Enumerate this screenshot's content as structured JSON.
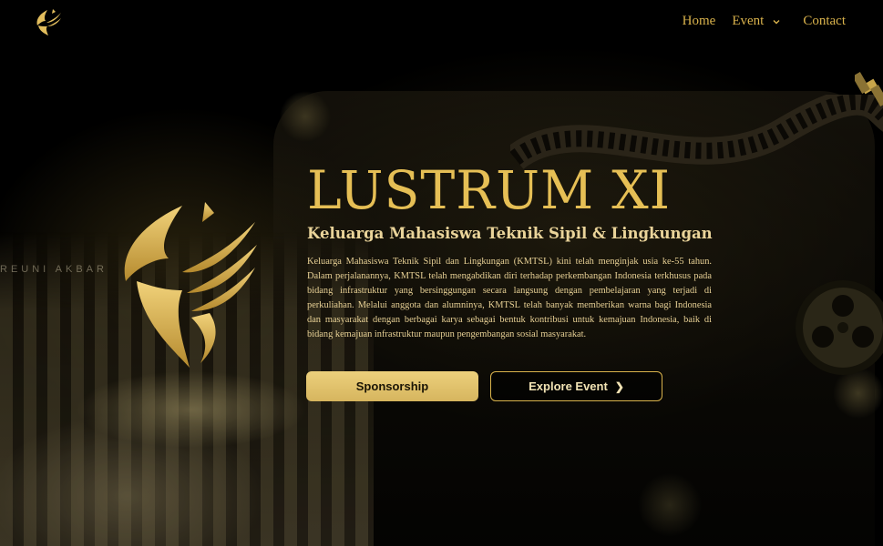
{
  "nav": {
    "logo_icon": "lustrum-emblem-icon",
    "home": "Home",
    "event": "Event",
    "event_chevron_icon": "chevron-down-icon",
    "contact": "Contact"
  },
  "hero": {
    "title": "LUSTRUM XI",
    "subtitle": "Keluarga Mahasiswa Teknik Sipil & Lingkungan",
    "description": "Keluarga Mahasiswa Teknik Sipil dan Lingkungan (KMTSL) kini telah menginjak usia ke-55 tahun. Dalam perjalanannya, KMTSL telah mengabdikan diri terhadap perkembangan Indonesia terkhusus pada bidang infrastruktur yang bersinggungan secara langsung dengan pembelajaran yang terjadi di perkuliahan. Melalui anggota dan alumninya, KMTSL telah banyak memberikan warna bagi Indonesia dan masyarakat dengan berbagai karya sebagai bentuk kontribusi untuk kemajuan Indonesia, baik di bidang kemajuan infrastruktur maupun pengembangan sosial masyarakat.",
    "sponsorship_label": "Sponsorship",
    "explore_label": "Explore Event",
    "explore_arrow": "❯"
  },
  "decor": {
    "background_text": "REUNI AKBAR",
    "emblem_icon": "lustrum-phoenix-emblem-icon",
    "film_strip_icon": "film-strip-icon",
    "film_reel_icon": "film-reel-icon",
    "satellite_icon": "satellite-icon"
  },
  "colors": {
    "gold": "#d9b24c",
    "gold_light": "#ecd07c",
    "background": "#000000"
  }
}
